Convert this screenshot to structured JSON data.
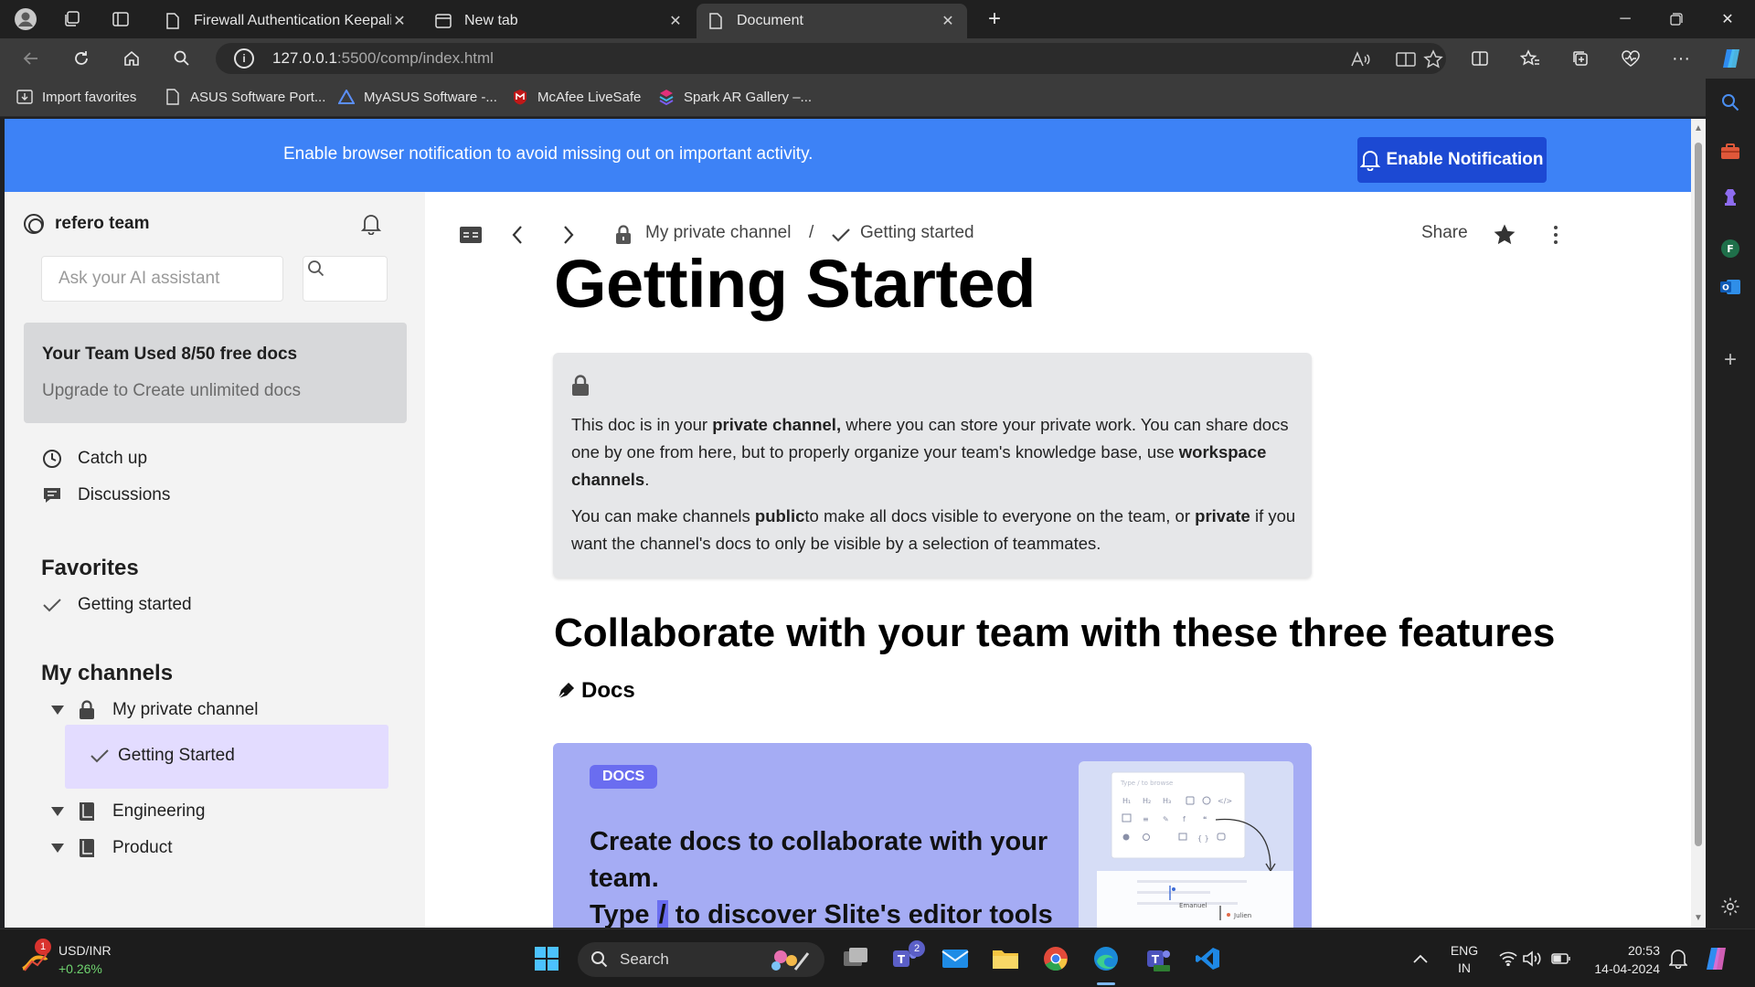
{
  "browser": {
    "tabs": [
      {
        "title": "Firewall Authentication Keepalive",
        "active": false
      },
      {
        "title": "New tab",
        "active": false
      },
      {
        "title": "Document",
        "active": true
      }
    ],
    "url_host": "127.0.0.1",
    "url_rest": ":5500/comp/index.html",
    "favorites": [
      {
        "label": "Import favorites",
        "icon": "import-icon"
      },
      {
        "label": "ASUS Software Port...",
        "icon": "page-icon"
      },
      {
        "label": "MyASUS Software -...",
        "icon": "asus-logo-icon"
      },
      {
        "label": "McAfee LiveSafe",
        "icon": "mcafee-logo-icon"
      },
      {
        "label": "Spark AR Gallery –...",
        "icon": "spark-ar-logo-icon"
      }
    ]
  },
  "banner": {
    "text": "Enable browser notification to avoid missing out on important activity.",
    "button": "Enable Notification",
    "color": "#3d82f6",
    "button_color": "#1c49d3"
  },
  "sidebar": {
    "team_name": "refero team",
    "ai_placeholder": "Ask your AI assistant",
    "usage_title": "Your Team Used 8/50 free docs",
    "usage_sub": "Upgrade to Create unlimited docs",
    "nav": [
      {
        "label": "Catch up",
        "icon": "clock-icon"
      },
      {
        "label": "Discussions",
        "icon": "chat-icon"
      }
    ],
    "favorites_heading": "Favorites",
    "favorites": [
      {
        "label": "Getting started",
        "icon": "check-icon"
      }
    ],
    "channels_heading": "My channels",
    "channels": [
      {
        "label": "My private channel",
        "icon": "lock-icon",
        "children": [
          {
            "label": "Getting Started",
            "active": true
          }
        ]
      },
      {
        "label": "Engineering",
        "icon": "book-icon"
      },
      {
        "label": "Product",
        "icon": "book-icon"
      }
    ],
    "active_color": "#e3dcff"
  },
  "main": {
    "breadcrumb_channel": "My private channel",
    "breadcrumb_sep": "/",
    "breadcrumb_doc": "Getting started",
    "share": "Share",
    "title": "Getting Started",
    "callout_p1_a": "This doc is in your ",
    "callout_p1_b": "private channel,",
    "callout_p1_c": " where you can store your private work. You can share docs one by one from here, but to properly organize your team's knowledge base, use ",
    "callout_p1_d": "workspace channels",
    "callout_p1_e": ".",
    "callout_p2_a": "You can make channels ",
    "callout_p2_b": "public",
    "callout_p2_c": "to make all docs visible to everyone on the team, or ",
    "callout_p2_d": "private",
    "callout_p2_e": " if you want the channel's docs to only be visible by a selection of teammates.",
    "section_title": "Collaborate with your team with these three features",
    "docs_label": "Docs",
    "card": {
      "badge": "DOCS",
      "title_1": "Create docs to collaborate with your team.",
      "title_2a": "Type ",
      "title_2b": "/",
      "title_2c": " to discover Slite's editor tools",
      "mock_placeholder": "Type / to browse",
      "mock_user_1": "Emanuel",
      "mock_user_2": "Julien",
      "color": "#a5acf4",
      "badge_color": "#6a6df0"
    }
  },
  "taskbar": {
    "ticker_symbol": "USD/INR",
    "ticker_change": "+0.26%",
    "ticker_badge": "1",
    "search_placeholder": "Search",
    "teams_badge": "2",
    "lang_1": "ENG",
    "lang_2": "IN",
    "time": "20:53",
    "date": "14-04-2024"
  }
}
